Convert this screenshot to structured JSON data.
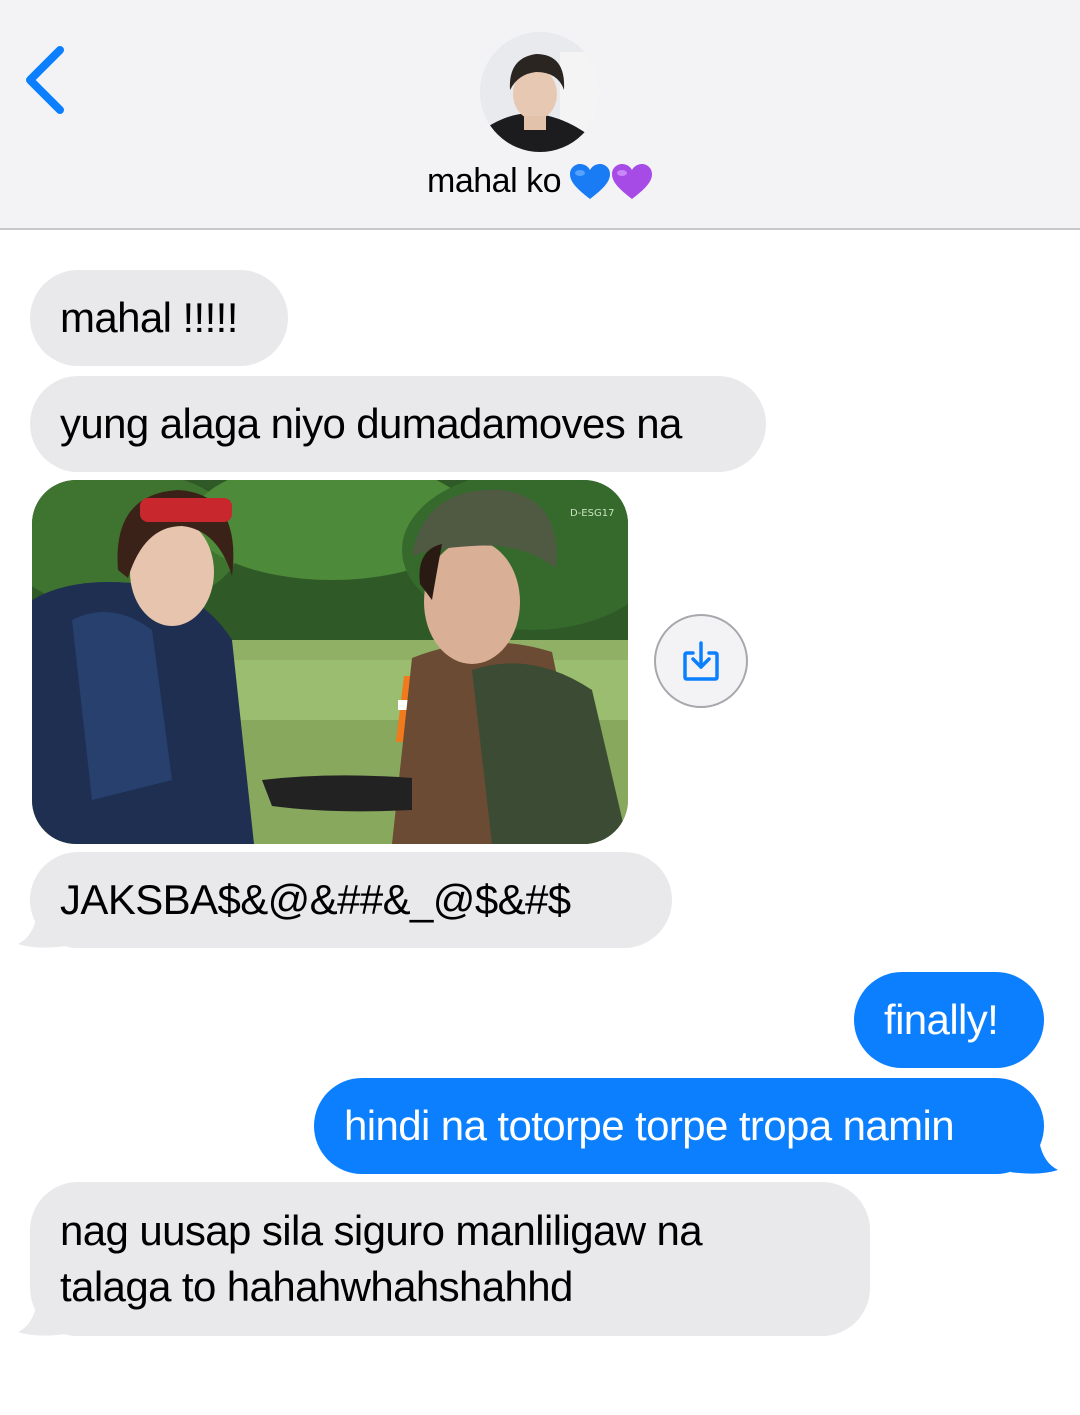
{
  "header": {
    "contact_name": "mahal ko",
    "hearts": [
      "blue-heart",
      "purple-heart"
    ],
    "accent_color": "#0b7ffe"
  },
  "messages": [
    {
      "direction": "incoming",
      "text": "mahal !!!!!"
    },
    {
      "direction": "incoming",
      "text": "yung alaga niyo dumadamoves na"
    },
    {
      "direction": "incoming",
      "type": "image",
      "watermark": "D-ESG17"
    },
    {
      "direction": "incoming",
      "text": "JAKSBA$&@&##&_@$&#$"
    },
    {
      "direction": "outgoing",
      "text": "finally!"
    },
    {
      "direction": "outgoing",
      "text": "hindi na totorpe torpe tropa namin"
    },
    {
      "direction": "incoming",
      "lines": [
        "nag uusap sila siguro manliligaw na",
        "talaga to hahahwhahshahhd"
      ]
    }
  ],
  "colors": {
    "incoming_bubble": "#e9e9eb",
    "outgoing_bubble": "#0b7ffe",
    "header_bg": "#f3f3f6"
  }
}
